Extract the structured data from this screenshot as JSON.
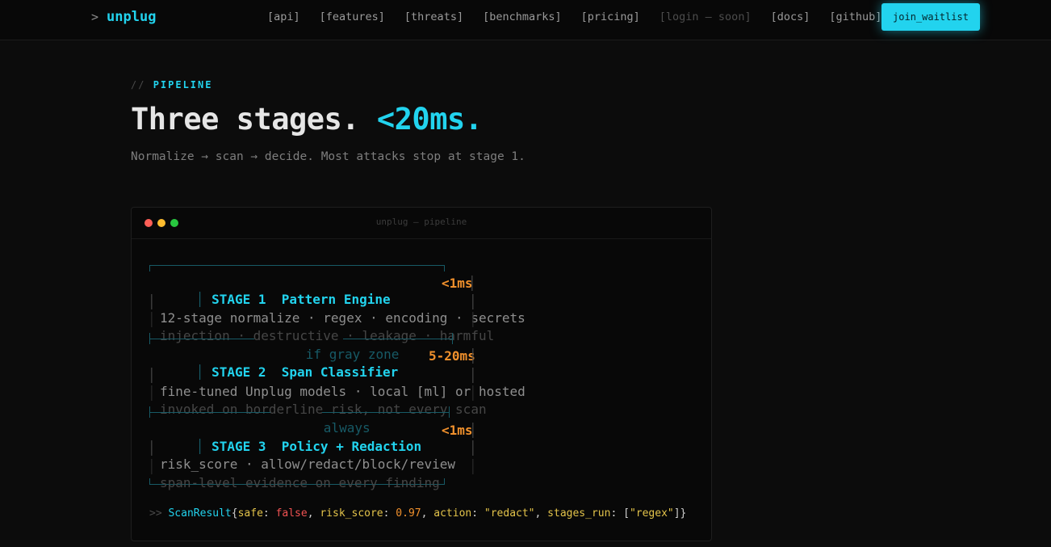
{
  "nav": {
    "prompt": ">",
    "logo": "unplug",
    "links": [
      "[api]",
      "[features]",
      "[threats]",
      "[benchmarks]",
      "[pricing]"
    ],
    "login": "[login — soon]",
    "docs": "[docs]",
    "github": "[github]",
    "cta": "join_waitlist"
  },
  "hero": {
    "eyebrow_prefix": "//",
    "eyebrow": "PIPELINE",
    "headline": "Three stages.",
    "headline_accent": "<20ms.",
    "subline": "Normalize → scan → decide. Most attacks stop at stage 1."
  },
  "terminal": {
    "title": "unplug — pipeline",
    "stages": [
      {
        "label": "STAGE 1  Pattern Engine",
        "timing": "<1ms",
        "line1": "12-stage normalize · regex · encoding · secrets",
        "line2": "injection · destructive · leakage · harmful"
      },
      {
        "label": "STAGE 2  Span Classifier",
        "timing": "5-20ms",
        "line1": "fine-tuned Unplug models · local [ml] or hosted",
        "line2": "invoked on borderline risk, not every scan"
      },
      {
        "label": "STAGE 3  Policy + Redaction",
        "timing": "<1ms",
        "line1": "risk_score · allow/redact/block/review",
        "line2": "span-level evidence on every finding"
      }
    ],
    "separators": [
      "if gray zone",
      "always"
    ],
    "result": {
      "prompt": ">>",
      "type": "ScanResult",
      "safe_key": "safe",
      "safe_val": "false",
      "risk_key": "risk_score",
      "risk_val": "0.97",
      "action_key": "action",
      "action_val": "\"redact\"",
      "stages_key": "stages_run",
      "stages_val": "\"regex\""
    }
  },
  "colors": {
    "accent": "#22d3ee",
    "timing": "#f0902c",
    "background": "#0c0c0c"
  }
}
